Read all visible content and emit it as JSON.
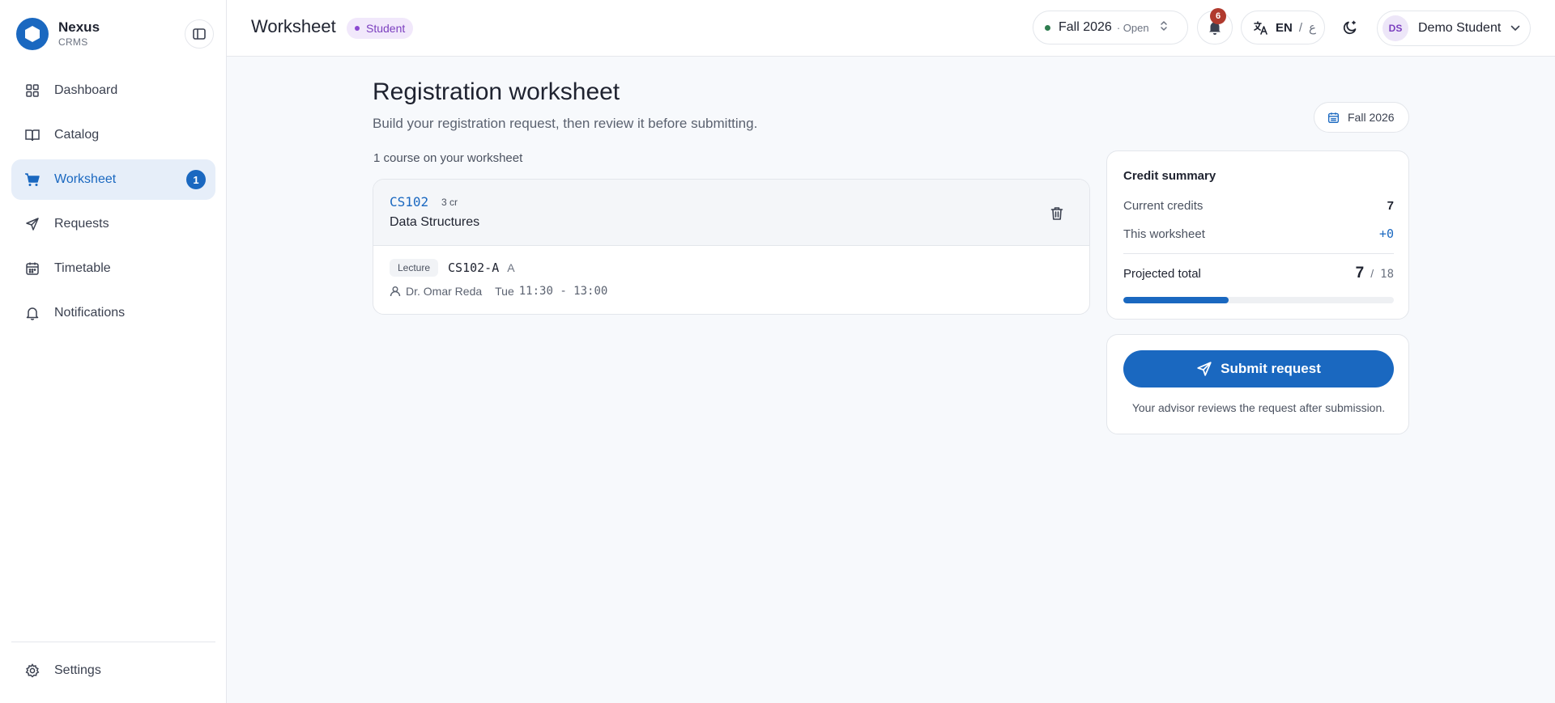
{
  "brand": {
    "name": "Nexus",
    "sub": "CRMS"
  },
  "sidebar": {
    "items": [
      {
        "label": "Dashboard",
        "icon": "grid-icon"
      },
      {
        "label": "Catalog",
        "icon": "book-icon"
      },
      {
        "label": "Worksheet",
        "icon": "cart-icon",
        "badge": "1",
        "active": true
      },
      {
        "label": "Requests",
        "icon": "send-icon"
      },
      {
        "label": "Timetable",
        "icon": "calendar-icon"
      },
      {
        "label": "Notifications",
        "icon": "bell-icon"
      }
    ],
    "settings_label": "Settings"
  },
  "header": {
    "title": "Worksheet",
    "role": "Student",
    "term": {
      "name": "Fall 2026",
      "status": "· Open"
    },
    "notification_count": "6",
    "lang": {
      "en": "EN",
      "sep": "/",
      "ar": "ع"
    },
    "user": {
      "initials": "DS",
      "name": "Demo Student"
    }
  },
  "main": {
    "title": "Registration worksheet",
    "subtitle": "Build your registration request, then review it before submitting.",
    "term_chip": "Fall 2026",
    "count_text": "1 course on your worksheet",
    "course": {
      "code": "CS102",
      "credits": "3 cr",
      "title": "Data Structures",
      "section_type": "Lecture",
      "section_code": "CS102-A",
      "section_letter": "A",
      "instructor": "Dr. Omar Reda",
      "day": "Tue",
      "time": "11:30 - 13:00"
    },
    "credit_summary": {
      "title": "Credit summary",
      "current_label": "Current credits",
      "current_value": "7",
      "worksheet_label": "This worksheet",
      "worksheet_value": "+0",
      "projected_label": "Projected total",
      "projected_value": "7",
      "projected_sep": "/",
      "projected_max": "18",
      "progress_fraction": 0.389
    },
    "submit": {
      "label": "Submit request",
      "note": "Your advisor reviews the request after submission."
    }
  },
  "colors": {
    "accent": "#1a68c0",
    "role_bg": "#f1e8fb",
    "role_fg": "#7b3fbf",
    "badge_red": "#b03a2e"
  }
}
